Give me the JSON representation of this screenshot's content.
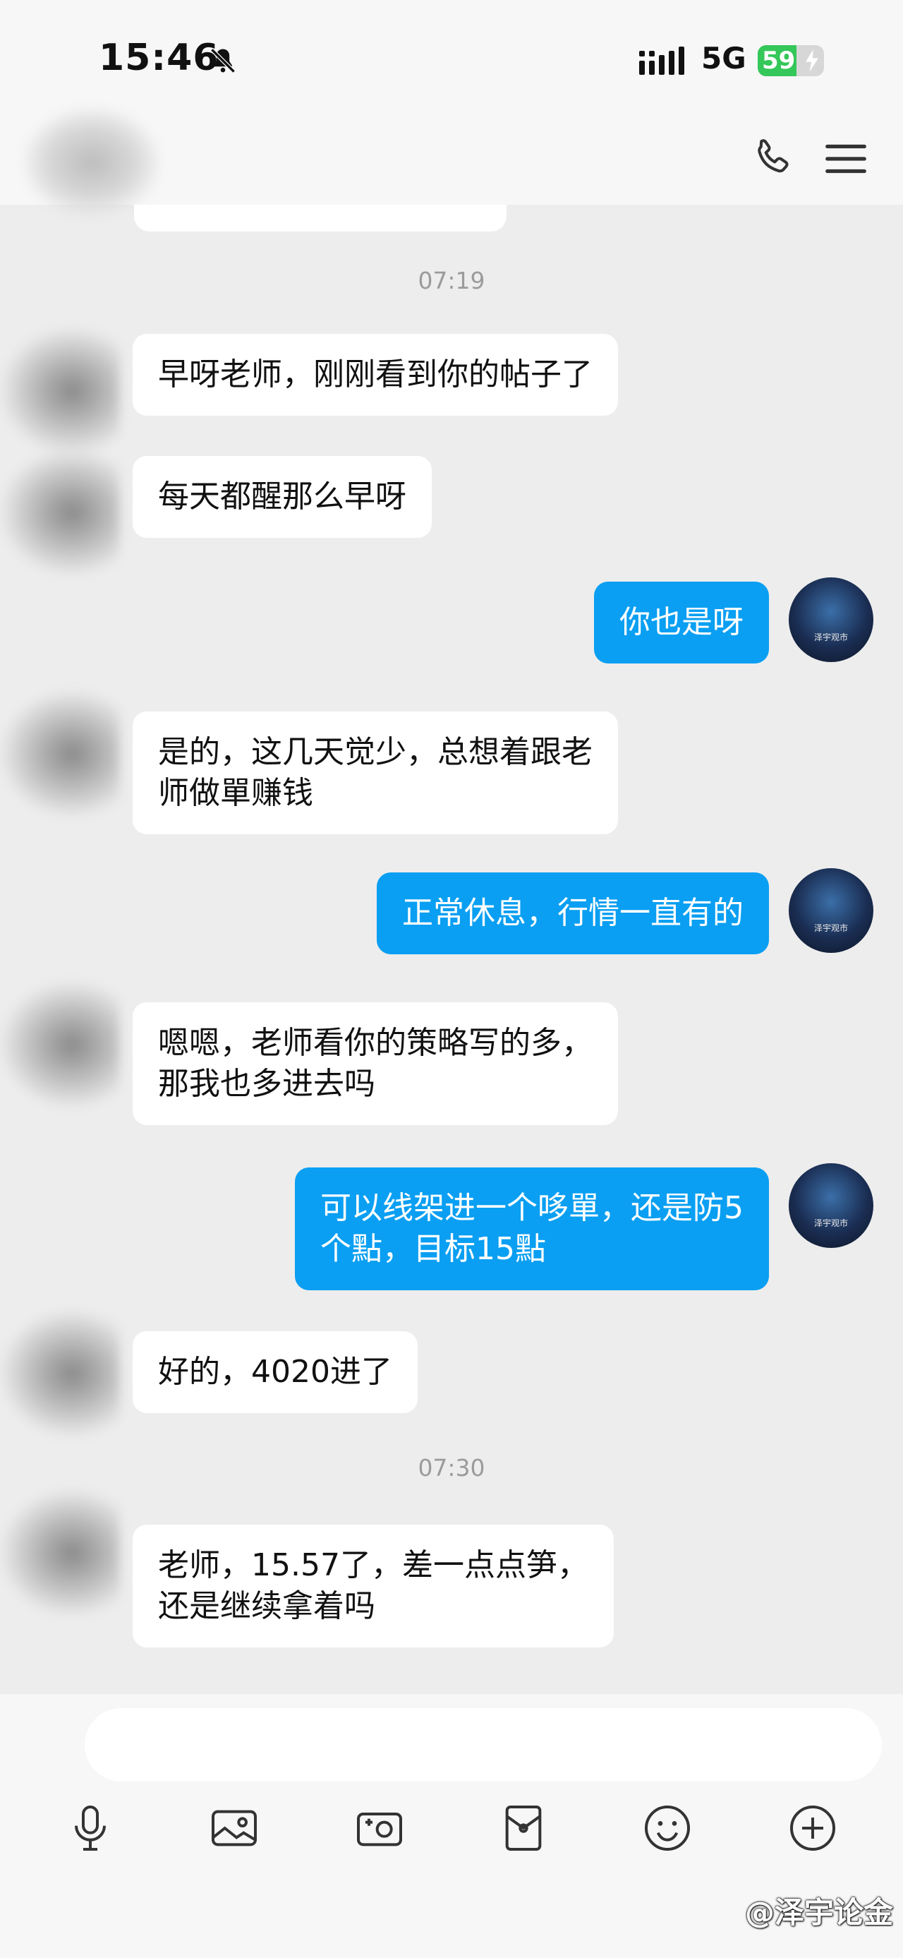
{
  "status_bar": {
    "time": "15:46",
    "network": "5G",
    "battery": "59",
    "battery_level_percent": 59
  },
  "header": {
    "icons": [
      "call-icon",
      "menu-icon"
    ]
  },
  "chat": {
    "timestamps": [
      "07:19",
      "07:30"
    ],
    "messages": [
      {
        "from": "contact",
        "lines": [
          "早呀老师，刚刚看到你的帖子了"
        ]
      },
      {
        "from": "contact",
        "lines": [
          "每天都醒那么早呀"
        ]
      },
      {
        "from": "me",
        "lines": [
          "你也是呀"
        ]
      },
      {
        "from": "contact",
        "lines": [
          "是的，这几天觉少，总想着跟老",
          "师做單赚钱"
        ]
      },
      {
        "from": "me",
        "lines": [
          "正常休息，行情一直有的"
        ]
      },
      {
        "from": "contact",
        "lines": [
          "嗯嗯，老师看你的策略写的多，",
          "那我也多进去吗"
        ]
      },
      {
        "from": "me",
        "lines": [
          "可以线架进一个哆單，还是防5",
          "个點，目标15點"
        ]
      },
      {
        "from": "contact",
        "lines": [
          "好的，4020进了"
        ]
      },
      {
        "from": "contact",
        "lines": [
          "老师，15.57了，差一点点笋，",
          "还是继续拿着吗"
        ]
      }
    ],
    "my_avatar_caption": "泽宇观市"
  },
  "input_bar": {
    "tools": [
      "microphone-icon",
      "image-icon",
      "camera-icon",
      "red-packet-icon",
      "emoji-icon",
      "plus-icon"
    ]
  },
  "watermark": "@泽宇论金"
}
